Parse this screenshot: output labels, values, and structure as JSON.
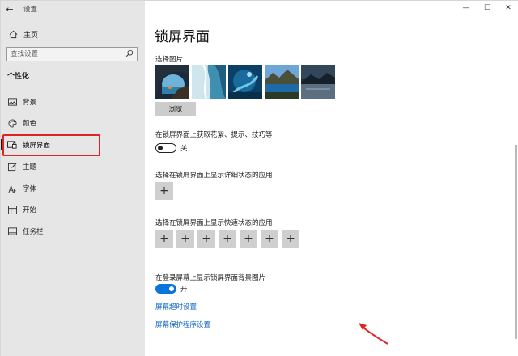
{
  "window": {
    "title": "设置",
    "controls": {
      "minimize": "—",
      "maximize": "☐",
      "close": "✕"
    }
  },
  "sidebar": {
    "back_glyph": "←",
    "home_label": "主页",
    "search_placeholder": "查找设置",
    "section": "个性化",
    "items": [
      {
        "label": "背景",
        "icon": "image-icon"
      },
      {
        "label": "颜色",
        "icon": "palette-icon"
      },
      {
        "label": "锁屏界面",
        "icon": "lock-screen-icon",
        "selected": true
      },
      {
        "label": "主题",
        "icon": "theme-icon"
      },
      {
        "label": "字体",
        "icon": "font-icon"
      },
      {
        "label": "开始",
        "icon": "start-icon"
      },
      {
        "label": "任务栏",
        "icon": "taskbar-icon"
      }
    ]
  },
  "main": {
    "title": "锁屏界面",
    "choose_picture_label": "选择图片",
    "browse_label": "浏览",
    "fun_facts_label": "在锁屏界面上获取花絮、提示、技巧等",
    "fun_facts_toggle": {
      "state": "off",
      "text": "关"
    },
    "detailed_status_label": "选择在锁屏界面上显示详细状态的应用",
    "quick_status_label": "选择在锁屏界面上显示快速状态的应用",
    "plus_glyph": "+",
    "signin_bg_label": "在登录屏幕上显示锁屏界面背景图片",
    "signin_bg_toggle": {
      "state": "on",
      "text": "开"
    },
    "screen_timeout_link": "屏幕超时设置",
    "screensaver_link": "屏幕保护程序设置"
  },
  "colors": {
    "accent": "#0a74da",
    "link": "#0a62c4",
    "highlight": "#e02424",
    "sidebar_bg": "#e6e6e6"
  }
}
